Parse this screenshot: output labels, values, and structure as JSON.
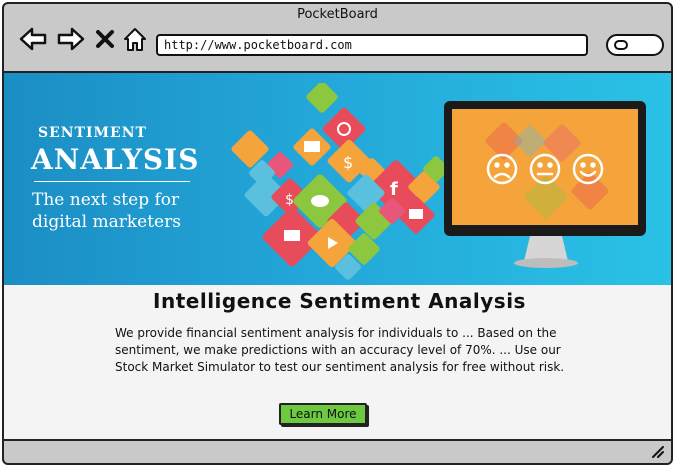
{
  "window": {
    "title": "PocketBoard"
  },
  "toolbar": {
    "url": "http://www.pocketboard.com"
  },
  "banner": {
    "title_small": "SENTIMENT",
    "title_large": "ANALYSIS",
    "subtitle_line1": "The next step for",
    "subtitle_line2": "digital marketers",
    "colors": {
      "red": "#e84b5a",
      "orange": "#f4a43b",
      "green": "#8dc63f",
      "pink": "#e8577a"
    }
  },
  "content": {
    "heading": "Intelligence Sentiment Analysis",
    "paragraph": "We provide financial sentiment analysis for individuals to ... Based on the sentiment, we make predictions with an accuracy level of 70%. ... Use our Stock Market Simulator to test our sentiment analysis for free without risk.",
    "button_label": "Learn More"
  }
}
